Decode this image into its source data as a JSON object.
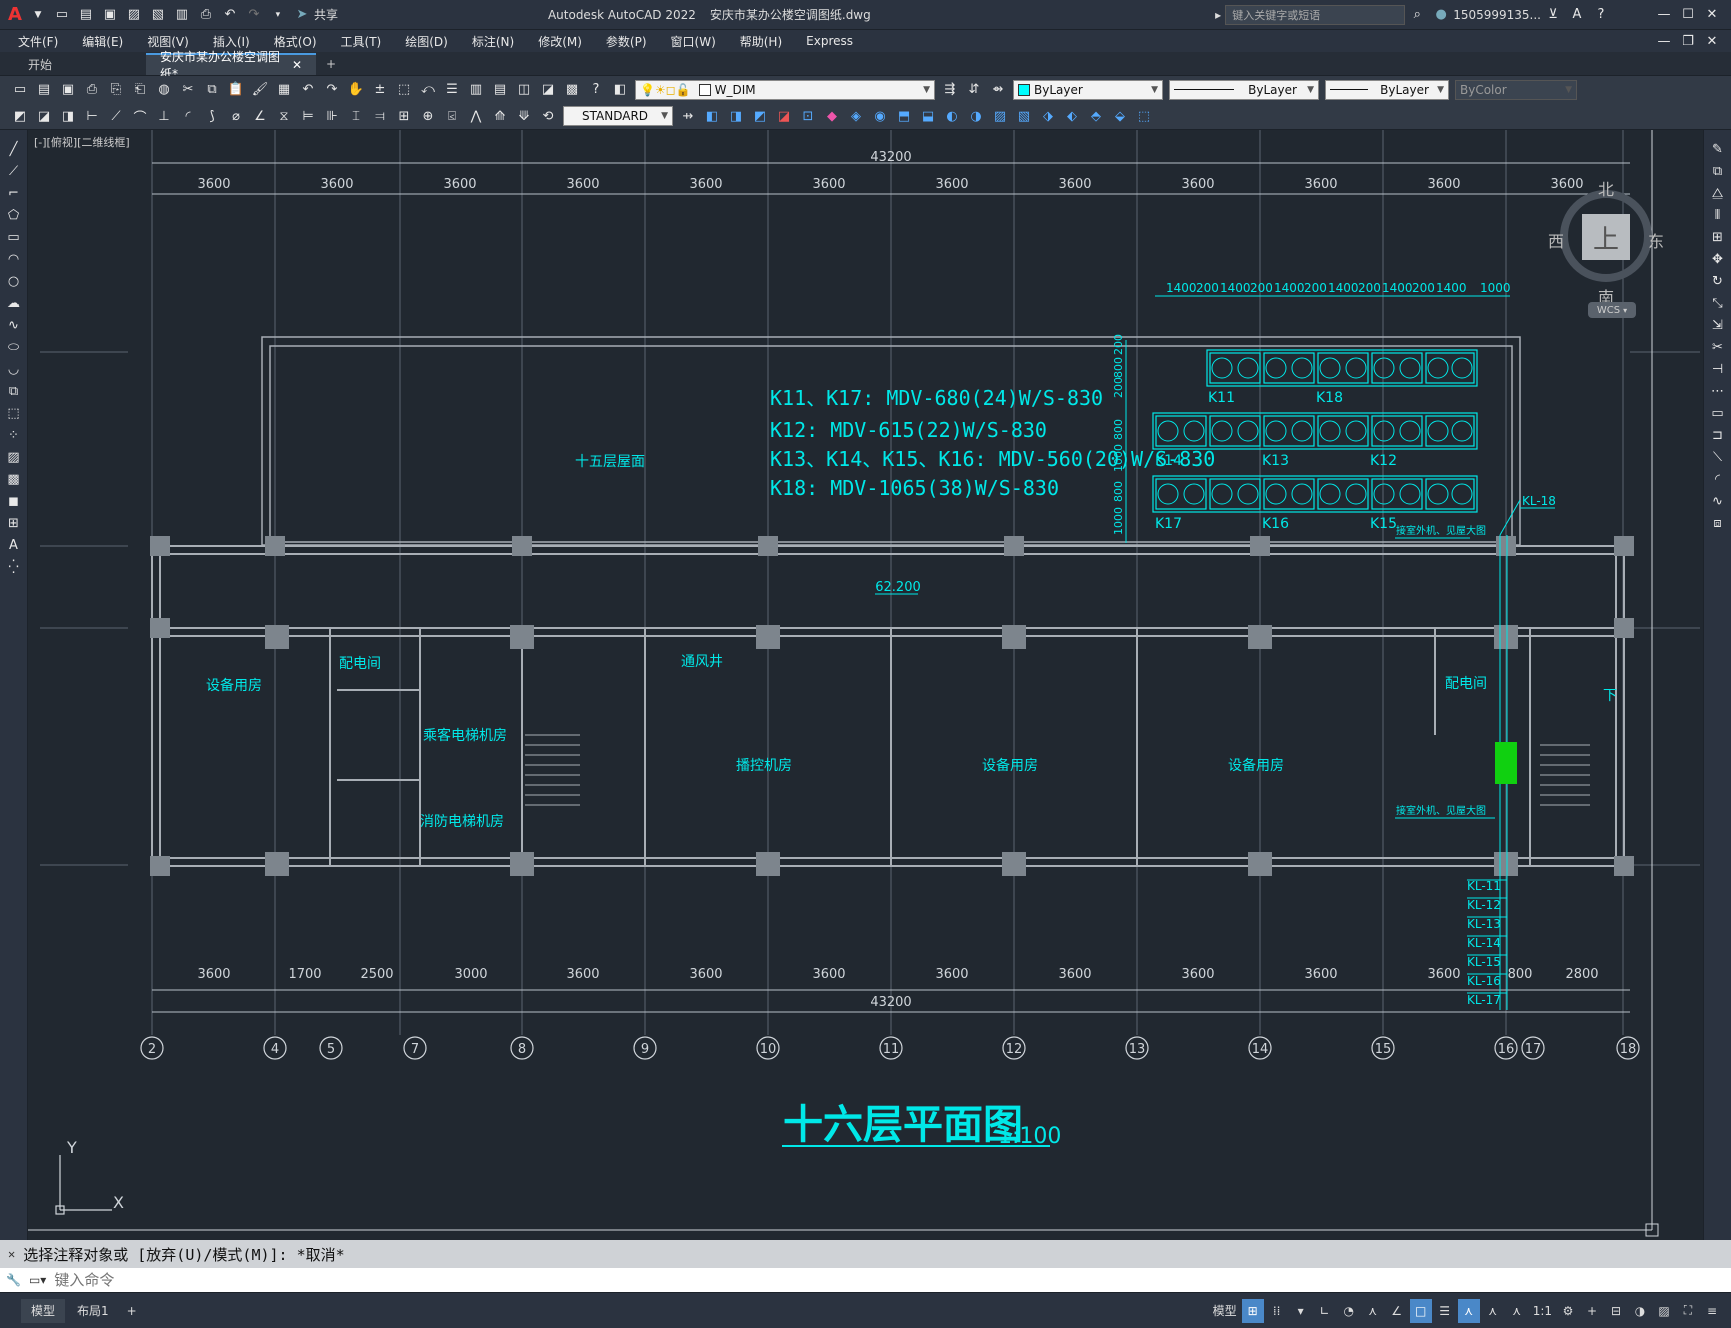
{
  "titlebar": {
    "app_logo": "A",
    "app_title": "Autodesk AutoCAD 2022",
    "doc_title": "安庆市某办公楼空调图纸.dwg",
    "share": "共享",
    "search_placeholder": "键入关键字或短语",
    "user": "1505999135...",
    "icons": [
      "new-icon",
      "open-icon",
      "save-icon",
      "saveas-icon",
      "open-web-icon",
      "save-web-icon",
      "plot-icon",
      "undo-icon",
      "redo-icon"
    ]
  },
  "menu": [
    "文件(F)",
    "编辑(E)",
    "视图(V)",
    "插入(I)",
    "格式(O)",
    "工具(T)",
    "绘图(D)",
    "标注(N)",
    "修改(M)",
    "参数(P)",
    "窗口(W)",
    "帮助(H)",
    "Express"
  ],
  "tabs": [
    {
      "label": "开始",
      "active": false
    },
    {
      "label": "安庆市某办公楼空调图纸*",
      "active": true
    }
  ],
  "layer": {
    "name": "W_DIM"
  },
  "props": {
    "color": "ByLayer",
    "linetype": "ByLayer",
    "lineweight": "ByLayer",
    "plotstyle": "ByColor"
  },
  "textstyle": "STANDARD",
  "viewport_label": "[-][俯视][二维线框]",
  "viewcube": {
    "top": "上",
    "north": "北",
    "south": "南",
    "east": "东",
    "west": "西",
    "wcs": "WCS"
  },
  "drawing": {
    "top_total": "43200",
    "bottom_total": "43200",
    "top_dims": [
      "3600",
      "3600",
      "3600",
      "3600",
      "3600",
      "3600",
      "3600",
      "3600",
      "3600",
      "3600",
      "3600",
      "3600"
    ],
    "bottom_dims": [
      "3600",
      "1700",
      "2500",
      "3000",
      "3600",
      "3600",
      "3600",
      "3600",
      "3600",
      "3600",
      "3600",
      "3600",
      "800",
      "2800"
    ],
    "axis_labels": [
      "2",
      "4",
      "5",
      "7",
      "8",
      "9",
      "10",
      "11",
      "12",
      "13",
      "14",
      "15",
      "16",
      "17",
      "18"
    ],
    "unit_top_dims": [
      "1400",
      "200",
      "1400",
      "200",
      "1400",
      "200",
      "1400",
      "200",
      "1400",
      "200",
      "1400",
      "1000"
    ],
    "unit_side_dims": [
      "200",
      "800",
      "200",
      "800",
      "1000",
      "800",
      "1000",
      "800",
      "1000"
    ],
    "unit_labels": [
      "K11",
      "K18",
      "K14",
      "K13",
      "K12",
      "K17",
      "K16",
      "K15"
    ],
    "spec_lines": [
      "K11、K17: MDV-680(24)W/S-830",
      "K12: MDV-615(22)W/S-830",
      "K13、K14、K15、K16: MDV-560(20)W/S-830",
      "K18: MDV-1065(38)W/S-830"
    ],
    "rooms": [
      "十五层屋面",
      "设备用房",
      "配电间",
      "乘客电梯机房",
      "消防电梯机房",
      "播控机房",
      "设备用房",
      "设备用房",
      "配电间",
      "通风井",
      "下"
    ],
    "level": "62.200",
    "kl_labels": [
      "KL-18",
      "KL-11",
      "KL-12",
      "KL-13",
      "KL-14",
      "KL-15",
      "KL-16",
      "KL-17"
    ],
    "pipe_notes": [
      "接室外机、见屋大图",
      "接室外机、见屋大图"
    ],
    "title": "十六层平面图",
    "scale": "1:100",
    "ucs_x": "X",
    "ucs_y": "Y"
  },
  "cmd": {
    "history": "选择注释对象或 [放弃(U)/模式(M)]: *取消*",
    "placeholder": "键入命令"
  },
  "status": {
    "layout_tabs": [
      "模型",
      "布局1"
    ],
    "add": "+",
    "model": "模型",
    "scale": "1:1"
  }
}
